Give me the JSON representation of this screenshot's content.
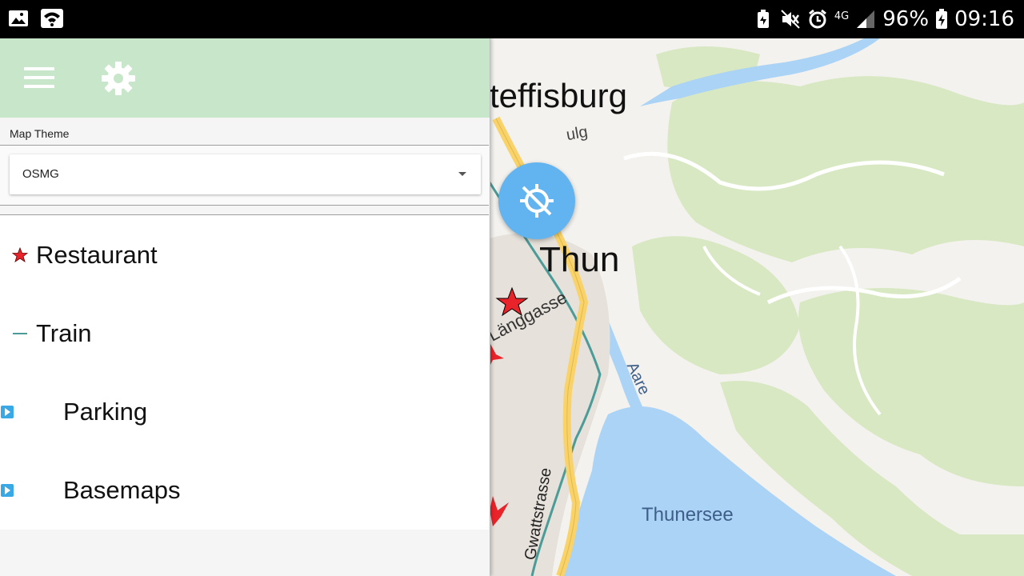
{
  "status_bar": {
    "battery": "96%",
    "network": "4G",
    "time": "09:16",
    "icons": [
      "image-icon",
      "wifi-icon",
      "battery-saver-icon",
      "mute-icon",
      "alarm-icon",
      "signal-icon",
      "battery-charging-icon"
    ]
  },
  "map": {
    "labels": {
      "town_top": "teffisburg",
      "town_center": "Thun",
      "street_partial": "ulg",
      "street_1": "Länggasse",
      "street_2": "Gwattstrasse",
      "river": "Aare",
      "lake": "Thunersee"
    },
    "colors": {
      "land": "#f2efe9",
      "forest": "#d8e8c2",
      "water": "#aad3f6",
      "road_main": "#f9d36a",
      "rail": "#4b9b98",
      "marker": "#e8232a"
    }
  },
  "fab": {
    "icon": "gps-off-icon",
    "color": "#62b4f0"
  },
  "drawer": {
    "toolbar": {
      "menu_icon": "menu-icon",
      "settings_icon": "settings-icon",
      "color": "#c8e6c9"
    },
    "map_theme": {
      "label": "Map Theme",
      "value": "OSMG"
    },
    "layers": [
      {
        "label": "Restaurant",
        "icon": "star-icon"
      },
      {
        "label": "Train",
        "icon": "line-icon"
      },
      {
        "label": "Parking",
        "icon": "expand-arrow-icon"
      },
      {
        "label": "Basemaps",
        "icon": "expand-arrow-icon"
      }
    ]
  }
}
